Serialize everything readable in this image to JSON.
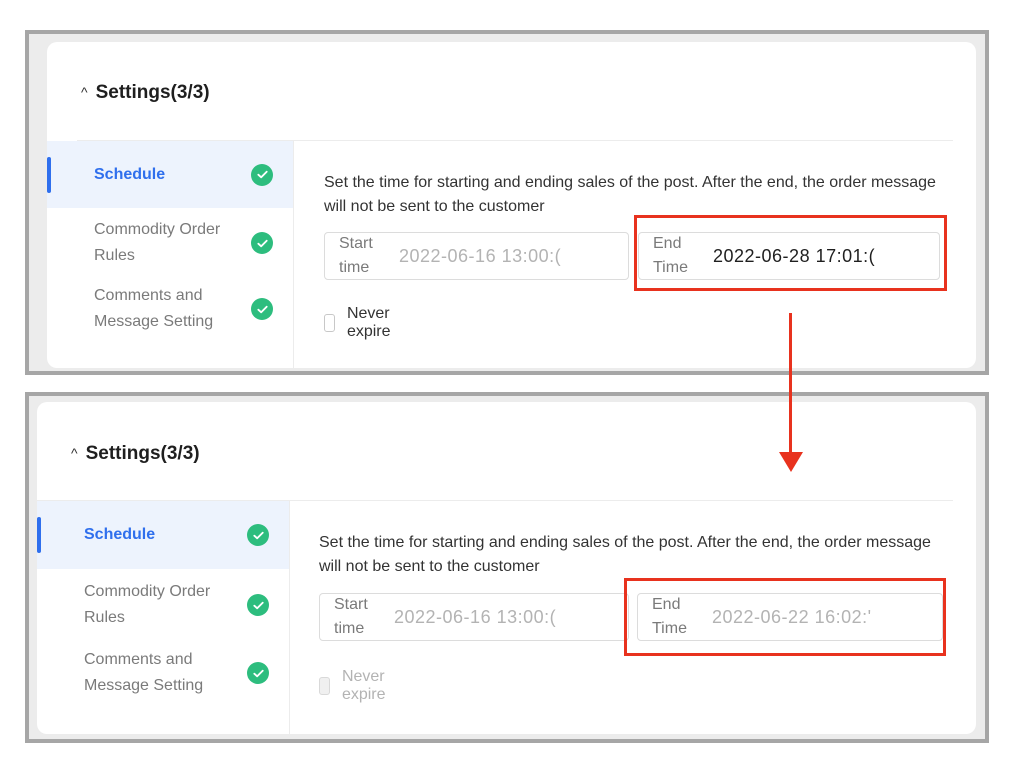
{
  "panels": [
    {
      "header": "Settings(3/3)",
      "nav": [
        {
          "label": "Schedule",
          "active": true
        },
        {
          "label": "Commodity Order Rules",
          "active": false
        },
        {
          "label": "Comments and Message Setting",
          "active": false
        }
      ],
      "description": "Set the time for starting and ending sales of the post. After the end, the order message will not be sent to the customer",
      "start_label": "Start time",
      "start_value": "2022-06-16 13:00:(",
      "end_label": "End Time",
      "end_value": "2022-06-28 17:01:(",
      "never_expire_label": "Never expire"
    },
    {
      "header": "Settings(3/3)",
      "nav": [
        {
          "label": "Schedule",
          "active": true
        },
        {
          "label": "Commodity Order Rules",
          "active": false
        },
        {
          "label": "Comments and Message Setting",
          "active": false
        }
      ],
      "description": "Set the time for starting and ending sales of the post. After the end, the order message will not be sent to the customer",
      "start_label": "Start time",
      "start_value": "2022-06-16 13:00:(",
      "end_label": "End Time",
      "end_value": "2022-06-22 16:02:'",
      "never_expire_label": "Never expire"
    }
  ],
  "colors": {
    "accent": "#2f6fed",
    "check": "#2dbd7e",
    "highlight": "#e8321e"
  },
  "icons": [
    "chevron-up-icon",
    "check-circle-icon",
    "arrow-down-icon"
  ]
}
